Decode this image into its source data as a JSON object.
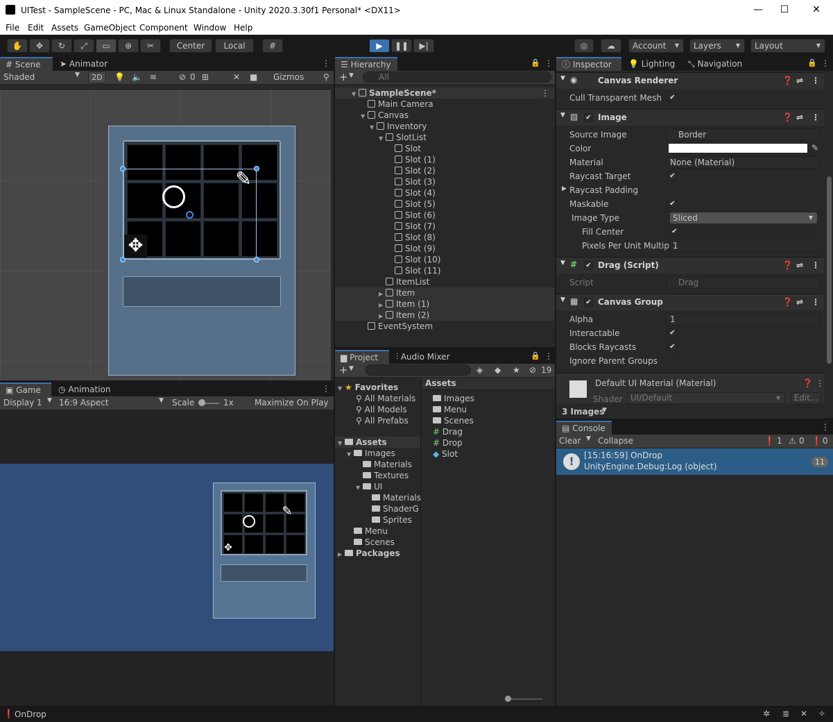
{
  "window": {
    "title": "UITest - SampleScene - PC, Mac & Linux Standalone - Unity 2020.3.30f1 Personal* <DX11>"
  },
  "menu": [
    "File",
    "Edit",
    "Assets",
    "GameObject",
    "Component",
    "Window",
    "Help"
  ],
  "toolbar": {
    "center": "Center",
    "local": "Local",
    "account": "Account",
    "layers": "Layers",
    "layout": "Layout"
  },
  "scene": {
    "tab": "Scene",
    "tab2": "Animator",
    "shading": "Shaded",
    "mode2d": "2D",
    "hidden_count": "0",
    "gizmos": "Gizmos"
  },
  "game": {
    "tab": "Game",
    "tab2": "Animation",
    "display": "Display 1",
    "aspect": "16:9 Aspect",
    "scale_label": "Scale",
    "scale_value": "1x",
    "maximize": "Maximize On Play"
  },
  "hierarchy": {
    "tab": "Hierarchy",
    "search_placeholder": "All",
    "items": [
      {
        "label": "SampleScene*",
        "indent": 0,
        "kind": "scene"
      },
      {
        "label": "Main Camera",
        "indent": 1,
        "kind": "go"
      },
      {
        "label": "Canvas",
        "indent": 1,
        "kind": "go"
      },
      {
        "label": "Inventory",
        "indent": 2,
        "kind": "go"
      },
      {
        "label": "SlotList",
        "indent": 3,
        "kind": "go"
      },
      {
        "label": "Slot",
        "indent": 4,
        "kind": "go"
      },
      {
        "label": "Slot (1)",
        "indent": 4,
        "kind": "go"
      },
      {
        "label": "Slot (2)",
        "indent": 4,
        "kind": "go"
      },
      {
        "label": "Slot (3)",
        "indent": 4,
        "kind": "go"
      },
      {
        "label": "Slot (4)",
        "indent": 4,
        "kind": "go"
      },
      {
        "label": "Slot (5)",
        "indent": 4,
        "kind": "go"
      },
      {
        "label": "Slot (6)",
        "indent": 4,
        "kind": "go"
      },
      {
        "label": "Slot (7)",
        "indent": 4,
        "kind": "go"
      },
      {
        "label": "Slot (8)",
        "indent": 4,
        "kind": "go"
      },
      {
        "label": "Slot (9)",
        "indent": 4,
        "kind": "go"
      },
      {
        "label": "Slot (10)",
        "indent": 4,
        "kind": "go"
      },
      {
        "label": "Slot (11)",
        "indent": 4,
        "kind": "go"
      },
      {
        "label": "ItemList",
        "indent": 3,
        "kind": "go"
      },
      {
        "label": "Item",
        "indent": 3,
        "kind": "go"
      },
      {
        "label": "Item (1)",
        "indent": 3,
        "kind": "go"
      },
      {
        "label": "Item (2)",
        "indent": 3,
        "kind": "go"
      },
      {
        "label": "EventSystem",
        "indent": 1,
        "kind": "go"
      }
    ]
  },
  "project": {
    "tab": "Project",
    "tab2": "Audio Mixer",
    "hidden_count": "19",
    "favorites_label": "Favorites",
    "favorites": [
      "All Materials",
      "All Models",
      "All Prefabs"
    ],
    "assets_label": "Assets",
    "tree": [
      {
        "label": "Images",
        "indent": 1
      },
      {
        "label": "Materials",
        "indent": 2
      },
      {
        "label": "Textures",
        "indent": 2
      },
      {
        "label": "UI",
        "indent": 2
      },
      {
        "label": "Materials",
        "indent": 3
      },
      {
        "label": "ShaderG",
        "indent": 3
      },
      {
        "label": "Sprites",
        "indent": 3
      },
      {
        "label": "Menu",
        "indent": 1
      },
      {
        "label": "Scenes",
        "indent": 1
      }
    ],
    "packages_label": "Packages",
    "breadcrumb": "Assets",
    "files": [
      {
        "label": "Images",
        "kind": "folder"
      },
      {
        "label": "Menu",
        "kind": "folder"
      },
      {
        "label": "Scenes",
        "kind": "folder"
      },
      {
        "label": "Drag",
        "kind": "script"
      },
      {
        "label": "Drop",
        "kind": "script"
      },
      {
        "label": "Slot",
        "kind": "prefab"
      }
    ]
  },
  "inspector": {
    "tab": "Inspector",
    "tab2": "Lighting",
    "tab3": "Navigation",
    "canvas_renderer": {
      "title": "Canvas Renderer",
      "cull_label": "Cull Transparent Mesh"
    },
    "image": {
      "title": "Image",
      "source_image_label": "Source Image",
      "source_image": "Border",
      "color_label": "Color",
      "material_label": "Material",
      "material": "None (Material)",
      "raycast_target_label": "Raycast Target",
      "raycast_padding_label": "Raycast Padding",
      "maskable_label": "Maskable",
      "image_type_label": "Image Type",
      "image_type": "Sliced",
      "fill_center_label": "Fill Center",
      "ppu_label": "Pixels Per Unit Multipli",
      "ppu": "1"
    },
    "drag": {
      "title": "Drag (Script)",
      "script_label": "Script",
      "script": "Drag"
    },
    "canvas_group": {
      "title": "Canvas Group",
      "alpha_label": "Alpha",
      "alpha": "1",
      "interactable_label": "Interactable",
      "blocks_label": "Blocks Raycasts",
      "ignore_label": "Ignore Parent Groups"
    },
    "material_section": {
      "title": "Default UI Material (Material)",
      "shader_label": "Shader",
      "shader": "UI/Default",
      "edit": "Edit..."
    },
    "preview": "3 Images"
  },
  "console": {
    "tab": "Console",
    "clear": "Clear",
    "collapse": "Collapse",
    "count_log": "1",
    "count_warn": "0",
    "count_err": "0",
    "entry_line1": "[15:16:59] OnDrop",
    "entry_line2": "UnityEngine.Debug:Log (object)",
    "entry_count": "11"
  },
  "status": {
    "message": "OnDrop"
  },
  "colors": {
    "accent": "#3a72b0",
    "panel": "#282828",
    "scene_bg": "#474747",
    "game_bg": "#314d79"
  }
}
